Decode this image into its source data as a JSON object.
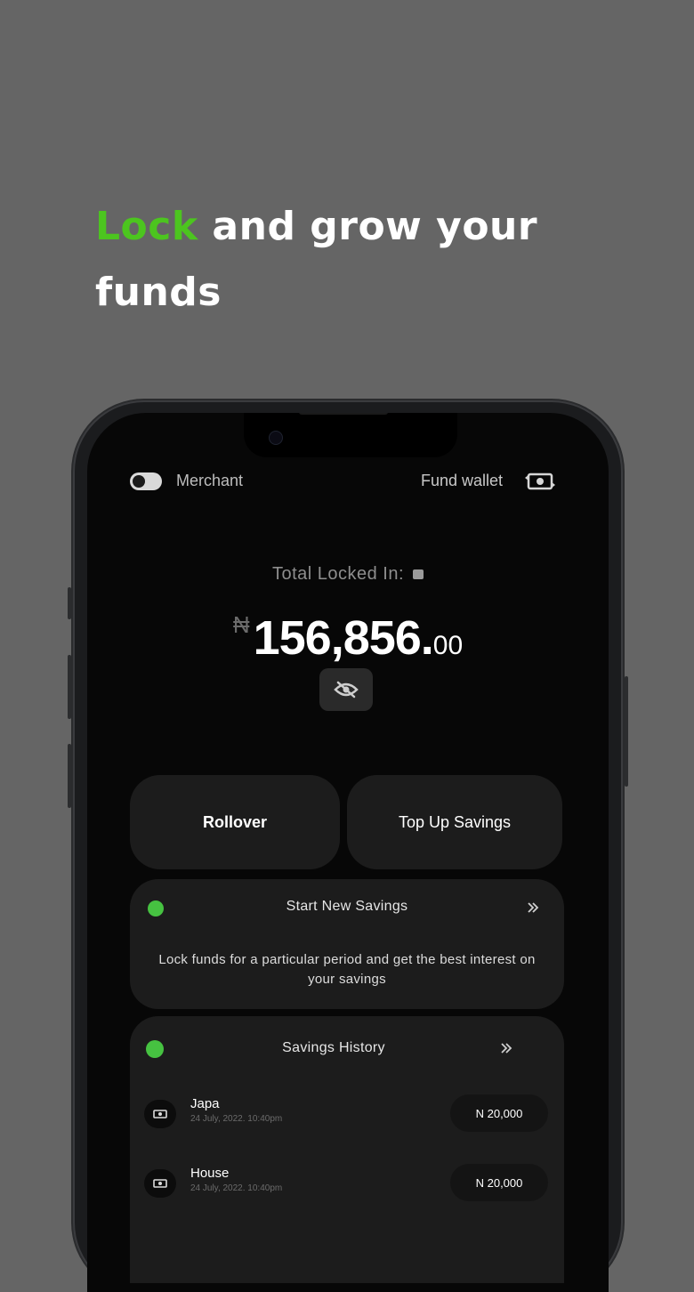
{
  "headline": {
    "highlight": "Lock",
    "rest": " and grow your funds"
  },
  "colors": {
    "accent_green": "#4cc51f",
    "status_dot": "#46c241",
    "background": "#656565",
    "screen": "#070707"
  },
  "topbar": {
    "merchant_label": "Merchant",
    "fund_wallet_label": "Fund wallet",
    "wallet_icon": "cash-transfer-icon"
  },
  "balance": {
    "label": "Total Locked In:",
    "currency": "₦",
    "amount": "156,856.",
    "decimals": "00",
    "toggle_icon": "eye-off-icon"
  },
  "actions": {
    "rollover": "Rollover",
    "top_up": "Top Up Savings"
  },
  "start_savings": {
    "title": "Start New Savings",
    "description": "Lock funds for a particular period and get the best interest on your savings"
  },
  "history": {
    "title": "Savings History",
    "items": [
      {
        "name": "Japa",
        "date": "24 July, 2022. 10:40pm",
        "amount": "N 20,000"
      },
      {
        "name": "House",
        "date": "24 July, 2022. 10:40pm",
        "amount": "N 20,000"
      }
    ]
  }
}
